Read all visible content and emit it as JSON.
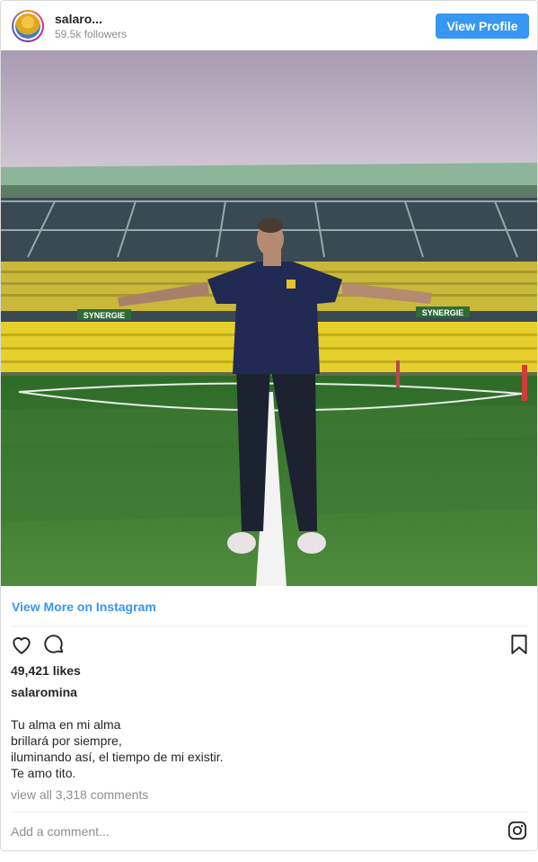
{
  "header": {
    "username": "salaro...",
    "followers": "59.5k followers",
    "view_profile_label": "View Profile"
  },
  "photo": {
    "banner_left": "SYNERGIE",
    "banner_right": "SYNERGIE"
  },
  "view_more_label": "View More on Instagram",
  "likes": "49,421 likes",
  "caption": {
    "username": "salaromina",
    "lines": [
      "Tu alma en mi alma",
      "brillará por siempre,",
      "iluminando así, el tiempo de mi existir.",
      "Te amo tito."
    ]
  },
  "comments_link": "view all 3,318 comments",
  "add_comment_placeholder": "Add a comment...",
  "icons": {
    "like": "heart-icon",
    "comment": "comment-icon",
    "save": "bookmark-icon",
    "instagram": "instagram-icon"
  },
  "colors": {
    "accent": "#3897f0",
    "muted_text": "#8e8e8e",
    "text": "#262626"
  }
}
